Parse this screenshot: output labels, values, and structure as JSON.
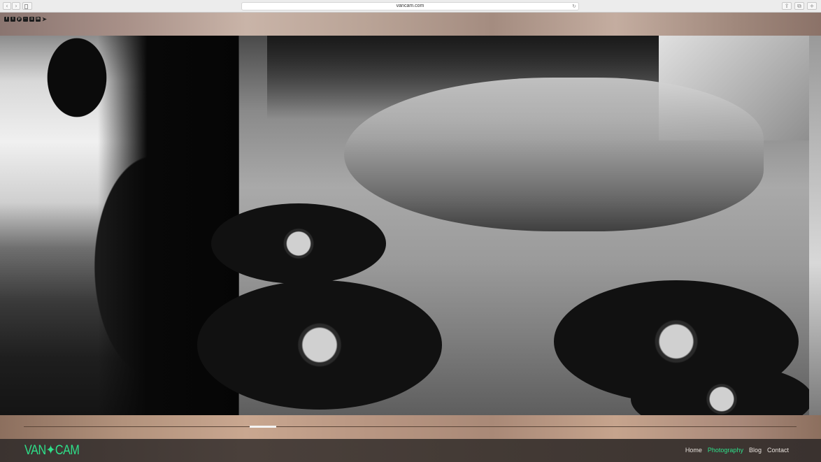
{
  "browser": {
    "url": "vancam.com",
    "back_glyph": "‹",
    "forward_glyph": "›",
    "reload_glyph": "↻",
    "share_glyph": "⇪",
    "tabs_glyph": "⧉",
    "newtab_glyph": "+"
  },
  "social": {
    "icons": [
      "facebook-icon",
      "twitter-icon",
      "pinterest-icon",
      "flickr-icon",
      "instagram-icon",
      "linkedin-icon",
      "arrow-icon"
    ],
    "facebook": "f",
    "twitter": "t",
    "pinterest": "p",
    "flickr": "··",
    "instagram": "◘",
    "linkedin": "in",
    "arrow": "➤"
  },
  "gallery": {
    "current_index": 1
  },
  "scrubber": {
    "position": 0.3
  },
  "footer": {
    "logo": "VAN✦CAM",
    "nav": [
      "Home",
      "Photography",
      "Blog",
      "Contact"
    ],
    "active_nav": "Photography",
    "accent_color": "#2ee08a"
  }
}
